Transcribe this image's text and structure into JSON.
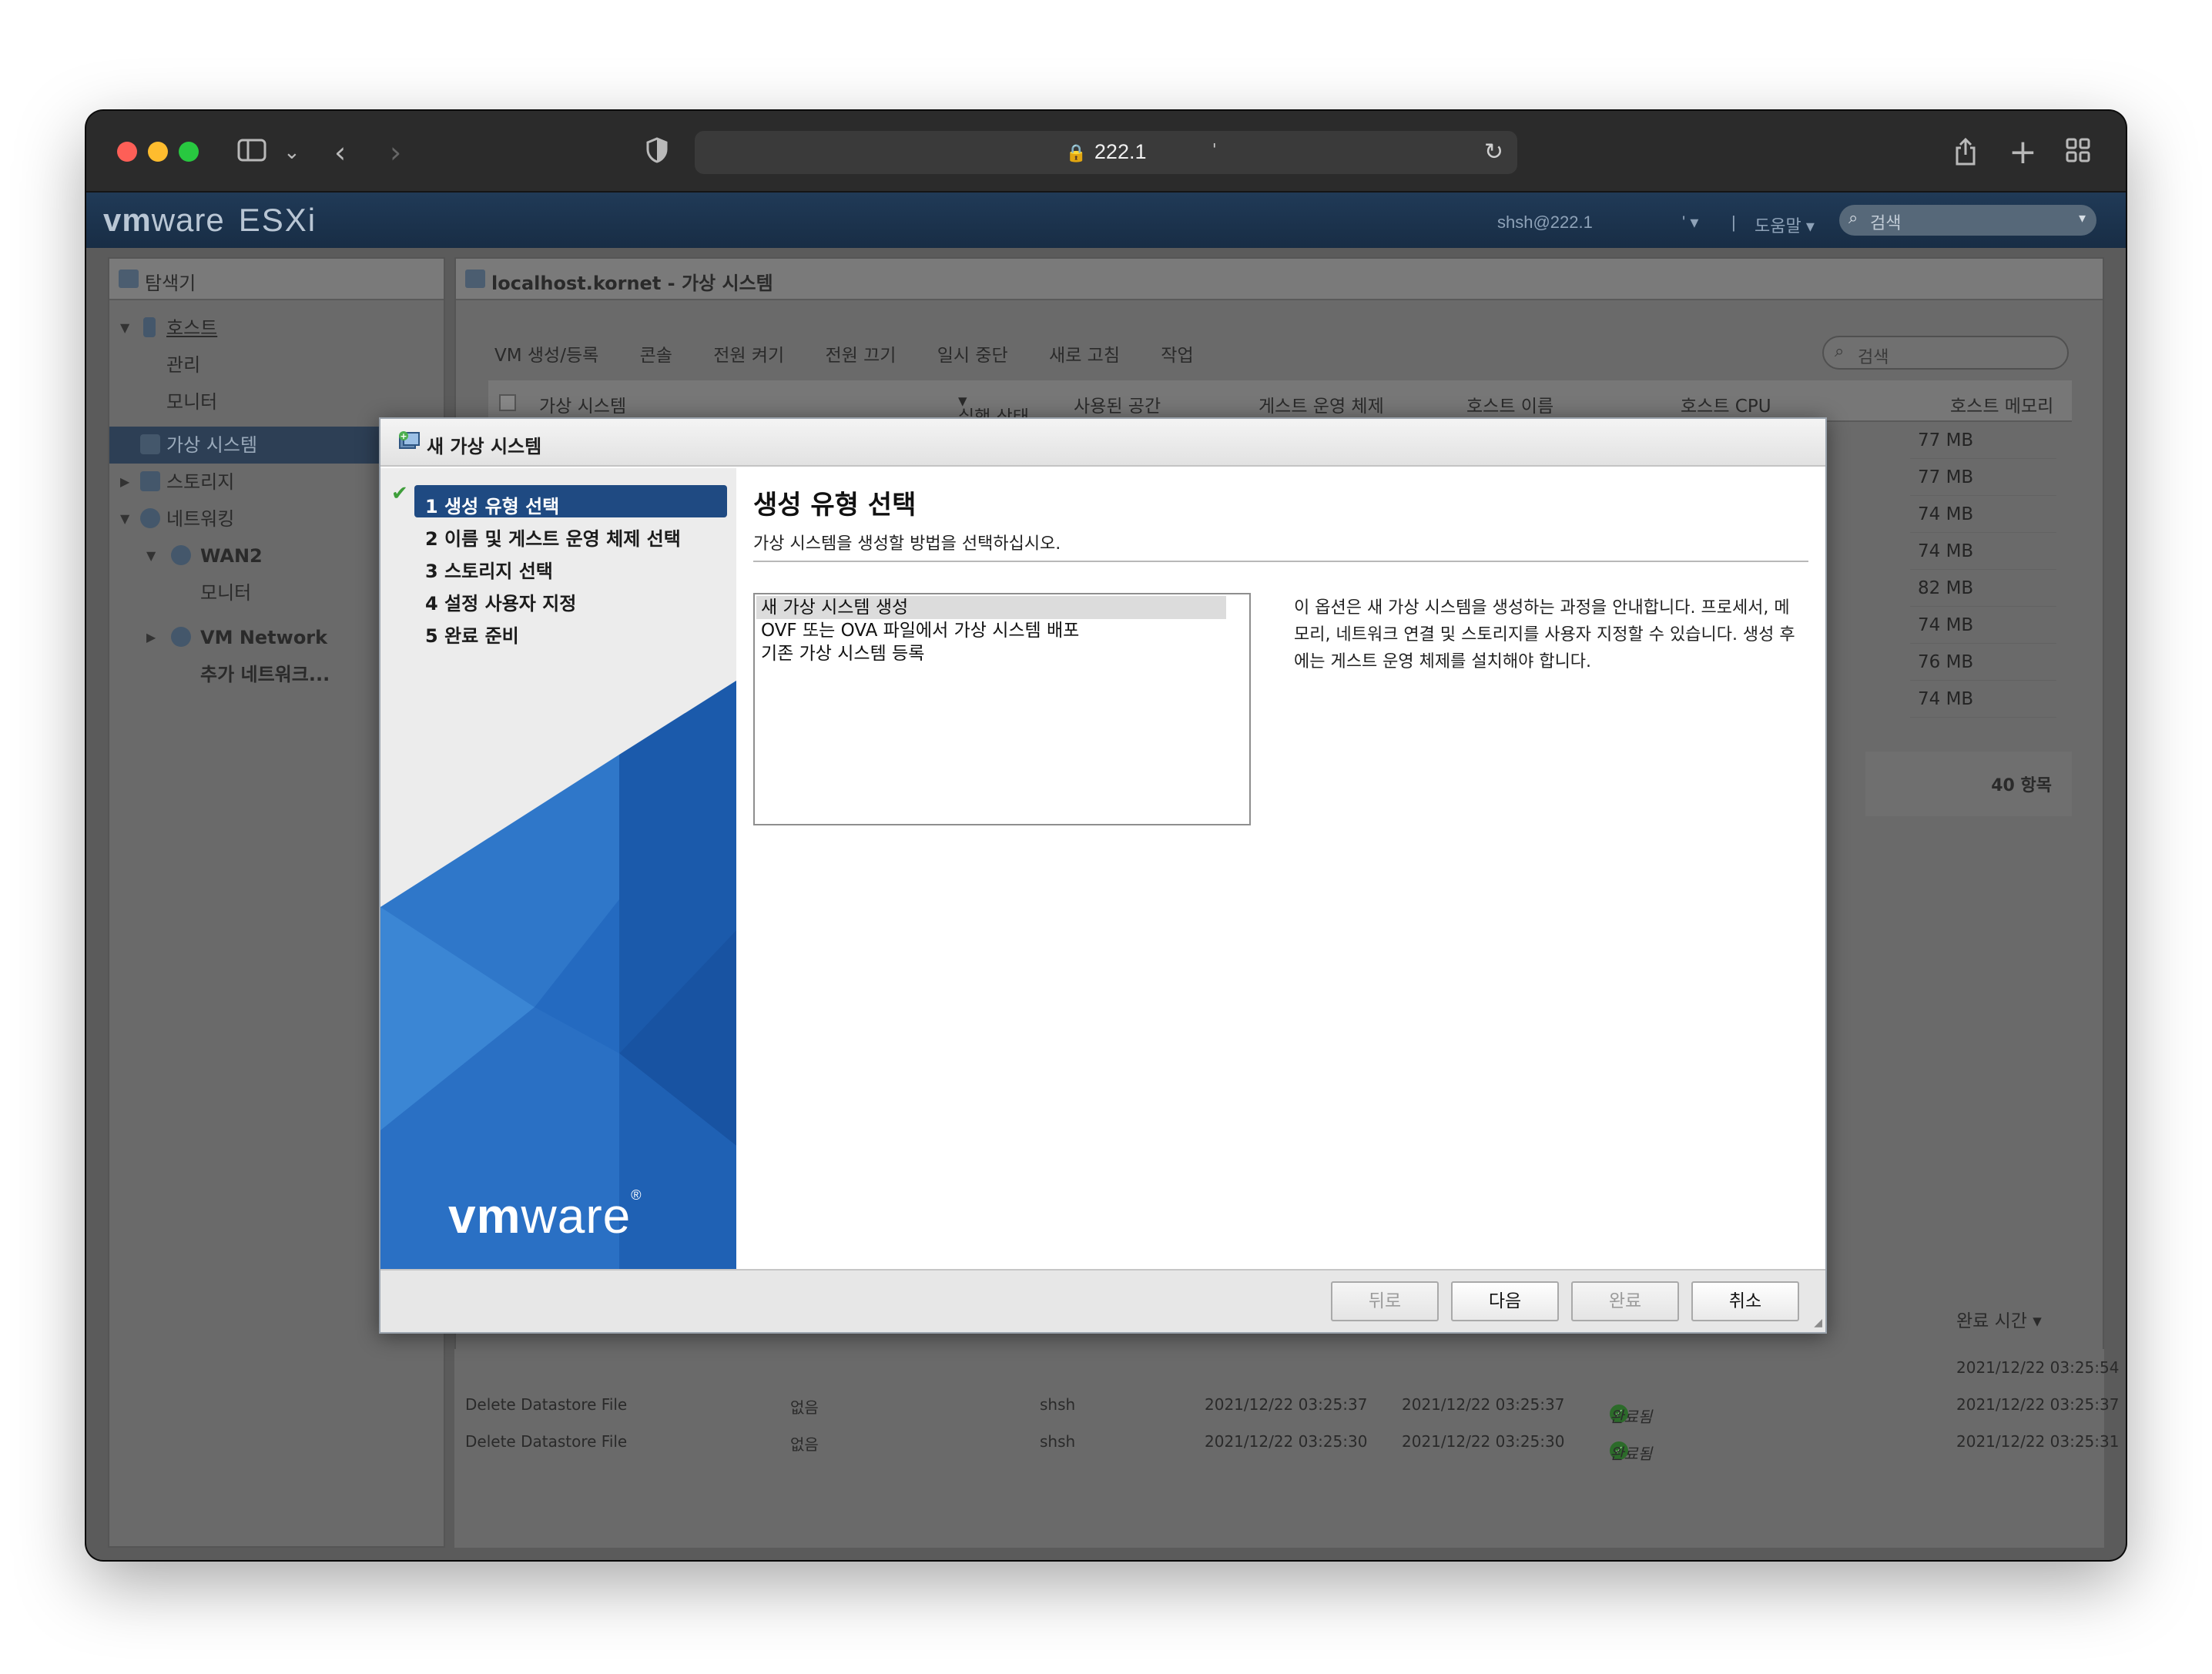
{
  "browser": {
    "url": "222.1",
    "url_suffix": "'",
    "icons": [
      "sidebar-icon",
      "chevron-down-icon",
      "back-icon",
      "forward-icon",
      "shield-icon",
      "lock-icon",
      "reload-icon",
      "share-icon",
      "plus-icon",
      "grid-icon"
    ]
  },
  "esxi_header": {
    "logo_vm": "vm",
    "logo_ware": "ware",
    "logo_product": "ESXi",
    "user": "shsh@222.1",
    "user_menu_mark": "'",
    "help": "도움말",
    "search_placeholder": "검색"
  },
  "navigator": {
    "title": "탐색기",
    "items": [
      {
        "label": "호스트"
      },
      {
        "label": "관리"
      },
      {
        "label": "모니터"
      },
      {
        "label": "가상 시스템"
      },
      {
        "label": "스토리지"
      },
      {
        "label": "네트워킹"
      },
      {
        "label": "WAN2"
      },
      {
        "label": "모니터"
      },
      {
        "label": "VM Network"
      },
      {
        "label": "추가 네트워크..."
      }
    ]
  },
  "main": {
    "title": "localhost.kornet - 가상 시스템",
    "toolbar": [
      "VM 생성/등록",
      "콘솔",
      "전원 켜기",
      "전원 끄기",
      "일시 중단",
      "새로 고침",
      "작업"
    ],
    "search_placeholder": "검색",
    "columns": [
      "가상 시스템",
      "실행 상태",
      "사용된 공간",
      "게스트 운영 체제",
      "호스트 이름",
      "호스트 CPU",
      "호스트 메모리"
    ],
    "memory_values": [
      "77 MB",
      "77 MB",
      "74 MB",
      "74 MB",
      "82 MB",
      "74 MB",
      "76 MB",
      "74 MB"
    ],
    "item_count": "40 항목"
  },
  "tasks": {
    "completion_header": "완료 시간 ▾",
    "first_completion": "2021/12/22 03:25:54",
    "rows": [
      {
        "task": "Delete Datastore File",
        "target": "없음",
        "initiator": "shsh",
        "queued": "2021/12/22 03:25:37",
        "started": "2021/12/22 03:25:37",
        "result": "완료됨",
        "completed": "2021/12/22 03:25:37"
      },
      {
        "task": "Delete Datastore File",
        "target": "없음",
        "initiator": "shsh",
        "queued": "2021/12/22 03:25:30",
        "started": "2021/12/22 03:25:30",
        "result": "완료됨",
        "completed": "2021/12/22 03:25:31"
      }
    ]
  },
  "dialog": {
    "title": "새 가상 시스템",
    "steps": [
      {
        "label": "1 생성 유형 선택"
      },
      {
        "label": "2 이름 및 게스트 운영 체제 선택"
      },
      {
        "label": "3 스토리지 선택"
      },
      {
        "label": "4 설정 사용자 지정"
      },
      {
        "label": "5 완료 준비"
      }
    ],
    "brand_vm": "vm",
    "brand_ware": "ware",
    "brand_reg": "®",
    "heading": "생성 유형 선택",
    "subheading": "가상 시스템을 생성할 방법을 선택하십시오.",
    "options": [
      "새 가상 시스템 생성",
      "OVF 또는 OVA 파일에서 가상 시스템 배포",
      "기존 가상 시스템 등록"
    ],
    "selected_option": "새 가상 시스템 생성",
    "description": "이 옵션은 새 가상 시스템을 생성하는 과정을 안내합니다. 프로세서, 메모리, 네트워크 연결 및 스토리지를 사용자 지정할 수 있습니다. 생성 후에는 게스트 운영 체제를 설치해야 합니다.",
    "buttons": {
      "back": "뒤로",
      "next": "다음",
      "finish": "완료",
      "cancel": "취소"
    }
  },
  "colors": {
    "esxi_header": "#1c3550",
    "active_step": "#1f4a82",
    "vmware_blue": "#1d5fb4",
    "success_green": "#3e9e3a"
  }
}
